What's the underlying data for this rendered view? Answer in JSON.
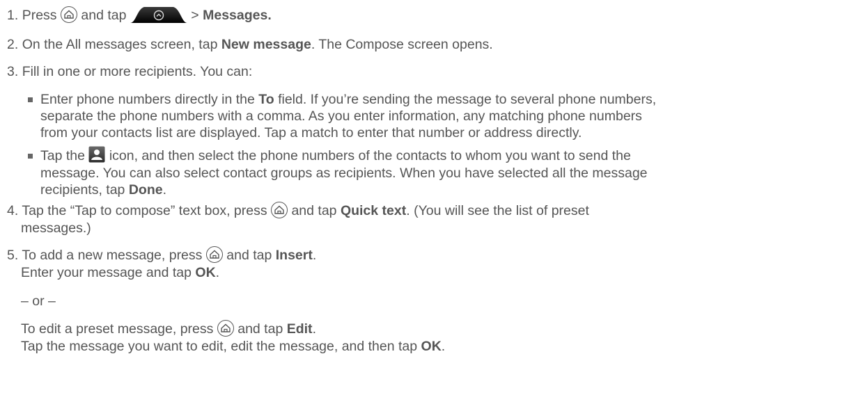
{
  "steps": [
    {
      "num": "1.",
      "a": "Press",
      "b": "and tap",
      "c": "> ",
      "c_bold": "Messages."
    },
    {
      "num": "2.",
      "a": "On the All messages screen, tap ",
      "a_bold": "New message",
      "b": ". The Compose screen opens."
    },
    {
      "num": "3.",
      "a": "Fill in one or more recipients. You can:"
    },
    {
      "num": "4.",
      "a": "Tap the “Tap to compose” text box, press",
      "b": "and tap ",
      "b_bold": "Quick text",
      "c": ". (You will see the list of preset",
      "d": "messages.)"
    },
    {
      "num": "5.",
      "a": "To add a new message, press",
      "b": "and tap ",
      "b_bold": "Insert",
      "c": "."
    }
  ],
  "bullets": [
    {
      "l1a": "Enter phone numbers directly in the ",
      "l1_bold": "To",
      "l1b": " field. If you’re sending the message to several phone numbers,",
      "l2": "separate the phone numbers with a comma. As you enter information, any matching phone numbers",
      "l3": "from your contacts list are displayed. Tap a match to enter that number or address directly."
    },
    {
      "l1a": "Tap the",
      "l1b": "icon, and then select the phone numbers of the contacts to whom you want to send the",
      "l2": "message. You can also select contact groups as recipients. When you have selected all the message",
      "l3a": "recipients, tap ",
      "l3_bold": "Done",
      "l3b": "."
    }
  ],
  "step5_extra": {
    "enter_a": "Enter your message and tap ",
    "enter_bold": "OK",
    "enter_b": ".",
    "or": "– or –",
    "edit_a": "To edit a preset message, press",
    "edit_b": "and tap ",
    "edit_bold": "Edit",
    "edit_c": ".",
    "final_a": "Tap the message you want to edit, edit the message, and then tap ",
    "final_bold": "OK",
    "final_b": "."
  },
  "icons": [
    "home-icon",
    "apps-tab-icon",
    "contact-icon"
  ]
}
